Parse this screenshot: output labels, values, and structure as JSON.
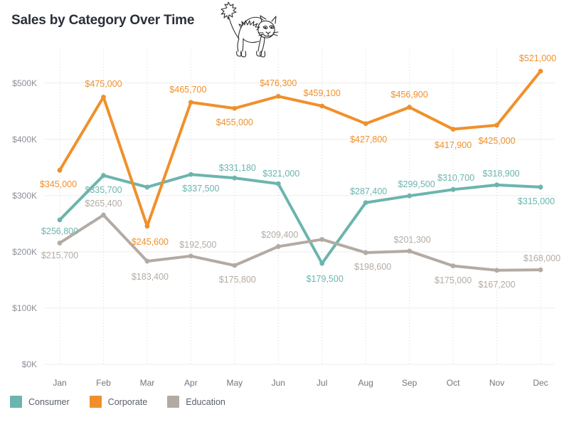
{
  "header": {
    "title": "Sales by Category Over Time",
    "decoration_icon": "arched-cat-icon"
  },
  "legend": {
    "position": "bottom-left",
    "items": [
      {
        "label": "Consumer",
        "color": "#6bb5ae"
      },
      {
        "label": "Corporate",
        "color": "#f0902b"
      },
      {
        "label": "Education",
        "color": "#b3aba3"
      }
    ]
  },
  "axes": {
    "y_ticks": [
      "$0K",
      "$100K",
      "$200K",
      "$300K",
      "$400K",
      "$500K"
    ],
    "y_values": [
      0,
      100000,
      200000,
      300000,
      400000,
      500000
    ],
    "x_ticks": [
      "Jan",
      "Feb",
      "Mar",
      "Apr",
      "May",
      "Jun",
      "Jul",
      "Aug",
      "Sep",
      "Oct",
      "Nov",
      "Dec"
    ]
  },
  "chart_data": {
    "type": "line",
    "title": "Sales by Category Over Time",
    "xlabel": "",
    "ylabel": "",
    "categories": [
      "Jan",
      "Feb",
      "Mar",
      "Apr",
      "May",
      "Jun",
      "Jul",
      "Aug",
      "Sep",
      "Oct",
      "Nov",
      "Dec"
    ],
    "ylim": [
      0,
      540000
    ],
    "y_tick_labels": [
      "$0K",
      "$100K",
      "$200K",
      "$300K",
      "$400K",
      "$500K"
    ],
    "grid": "horizontal-solid-and-vertical-dotted",
    "legend_position": "bottom-left",
    "markers": true,
    "data_labels": true,
    "series": [
      {
        "name": "Consumer",
        "color": "#6bb5ae",
        "values": [
          256800,
          335700,
          315000,
          337500,
          331180,
          321000,
          179500,
          287400,
          299500,
          310700,
          318900,
          315000
        ],
        "labels": [
          "$256,800",
          "$335,700",
          null,
          "$337,500",
          "$331,180",
          "$321,000",
          "$179,500",
          "$287,400",
          "$299,500",
          "$310,700",
          "$318,900",
          "$315,000"
        ]
      },
      {
        "name": "Corporate",
        "color": "#f0902b",
        "values": [
          345000,
          475000,
          245600,
          465700,
          455000,
          476300,
          459100,
          427800,
          456900,
          417900,
          425000,
          521000
        ],
        "labels": [
          "$345,000",
          "$475,000",
          "$245,600",
          "$465,700",
          "$455,000",
          "$476,300",
          "$459,100",
          "$427,800",
          "$456,900",
          "$417,900",
          "$425,000",
          "$521,000"
        ]
      },
      {
        "name": "Education",
        "color": "#b3aba3",
        "values": [
          215700,
          265400,
          183400,
          192500,
          175800,
          209400,
          222000,
          198600,
          201300,
          175000,
          167200,
          168000
        ],
        "labels": [
          "$215,700",
          "$265,400",
          "$183,400",
          "$192,500",
          "$175,800",
          "$209,400",
          null,
          "$198,600",
          "$201,300",
          "$175,000",
          "$167,200",
          "$168,000"
        ]
      }
    ]
  },
  "style": {
    "background": "#ffffff",
    "title_color": "#2b2f3a",
    "axis_text_color": "#8b8f98",
    "gridline_color": "#ededed",
    "vertical_gridline_color": "#d8d8d8"
  }
}
